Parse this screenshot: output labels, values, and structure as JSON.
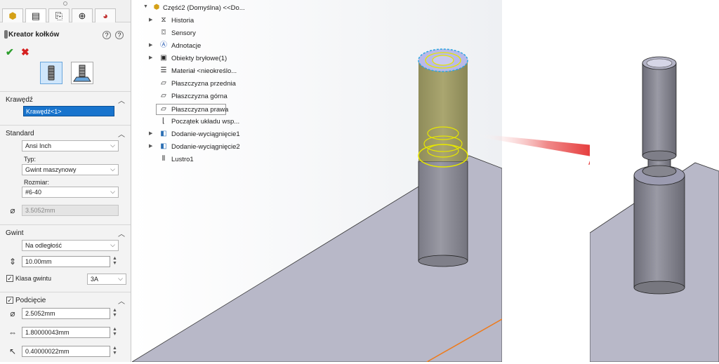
{
  "panel": {
    "title": "Kreator kołków",
    "edge_section": "Krawędź",
    "edge_value": "Krawędź<1>",
    "standard_section": "Standard",
    "standard_value": "Ansi Inch",
    "type_label": "Typ:",
    "type_value": "Gwint maszynowy",
    "size_label": "Rozmiar:",
    "size_value": "#6-40",
    "diameter_value": "3.5052mm",
    "thread_section": "Gwint",
    "thread_mode": "Na odległość",
    "thread_length": "10.00mm",
    "thread_class_label": "Klasa gwintu",
    "thread_class_value": "3A",
    "undercut_section": "Podcięcie",
    "undercut_diameter": "2.5052mm",
    "undercut_length": "1.80000043mm",
    "undercut_radius": "0.40000022mm"
  },
  "tree": {
    "root": "Część2 (Domyślna) <<Do...",
    "items": [
      "Historia",
      "Sensory",
      "Adnotacje",
      "Obiekty bryłowe(1)",
      "Materiał <nieokreślo...",
      "Płaszczyzna przednia",
      "Płaszczyzna górna",
      "Płaszczyzna prawa",
      "Początek układu wsp...",
      "Dodanie-wyciągnięcie1",
      "Dodanie-wyciągnięcie2",
      "Lustro1"
    ]
  },
  "colors": {
    "accent": "#1874cd",
    "highlight": "#e6e600",
    "arrow": "#e01010",
    "plate": "#b9b9c9",
    "cylinder": "#8f8f99"
  }
}
